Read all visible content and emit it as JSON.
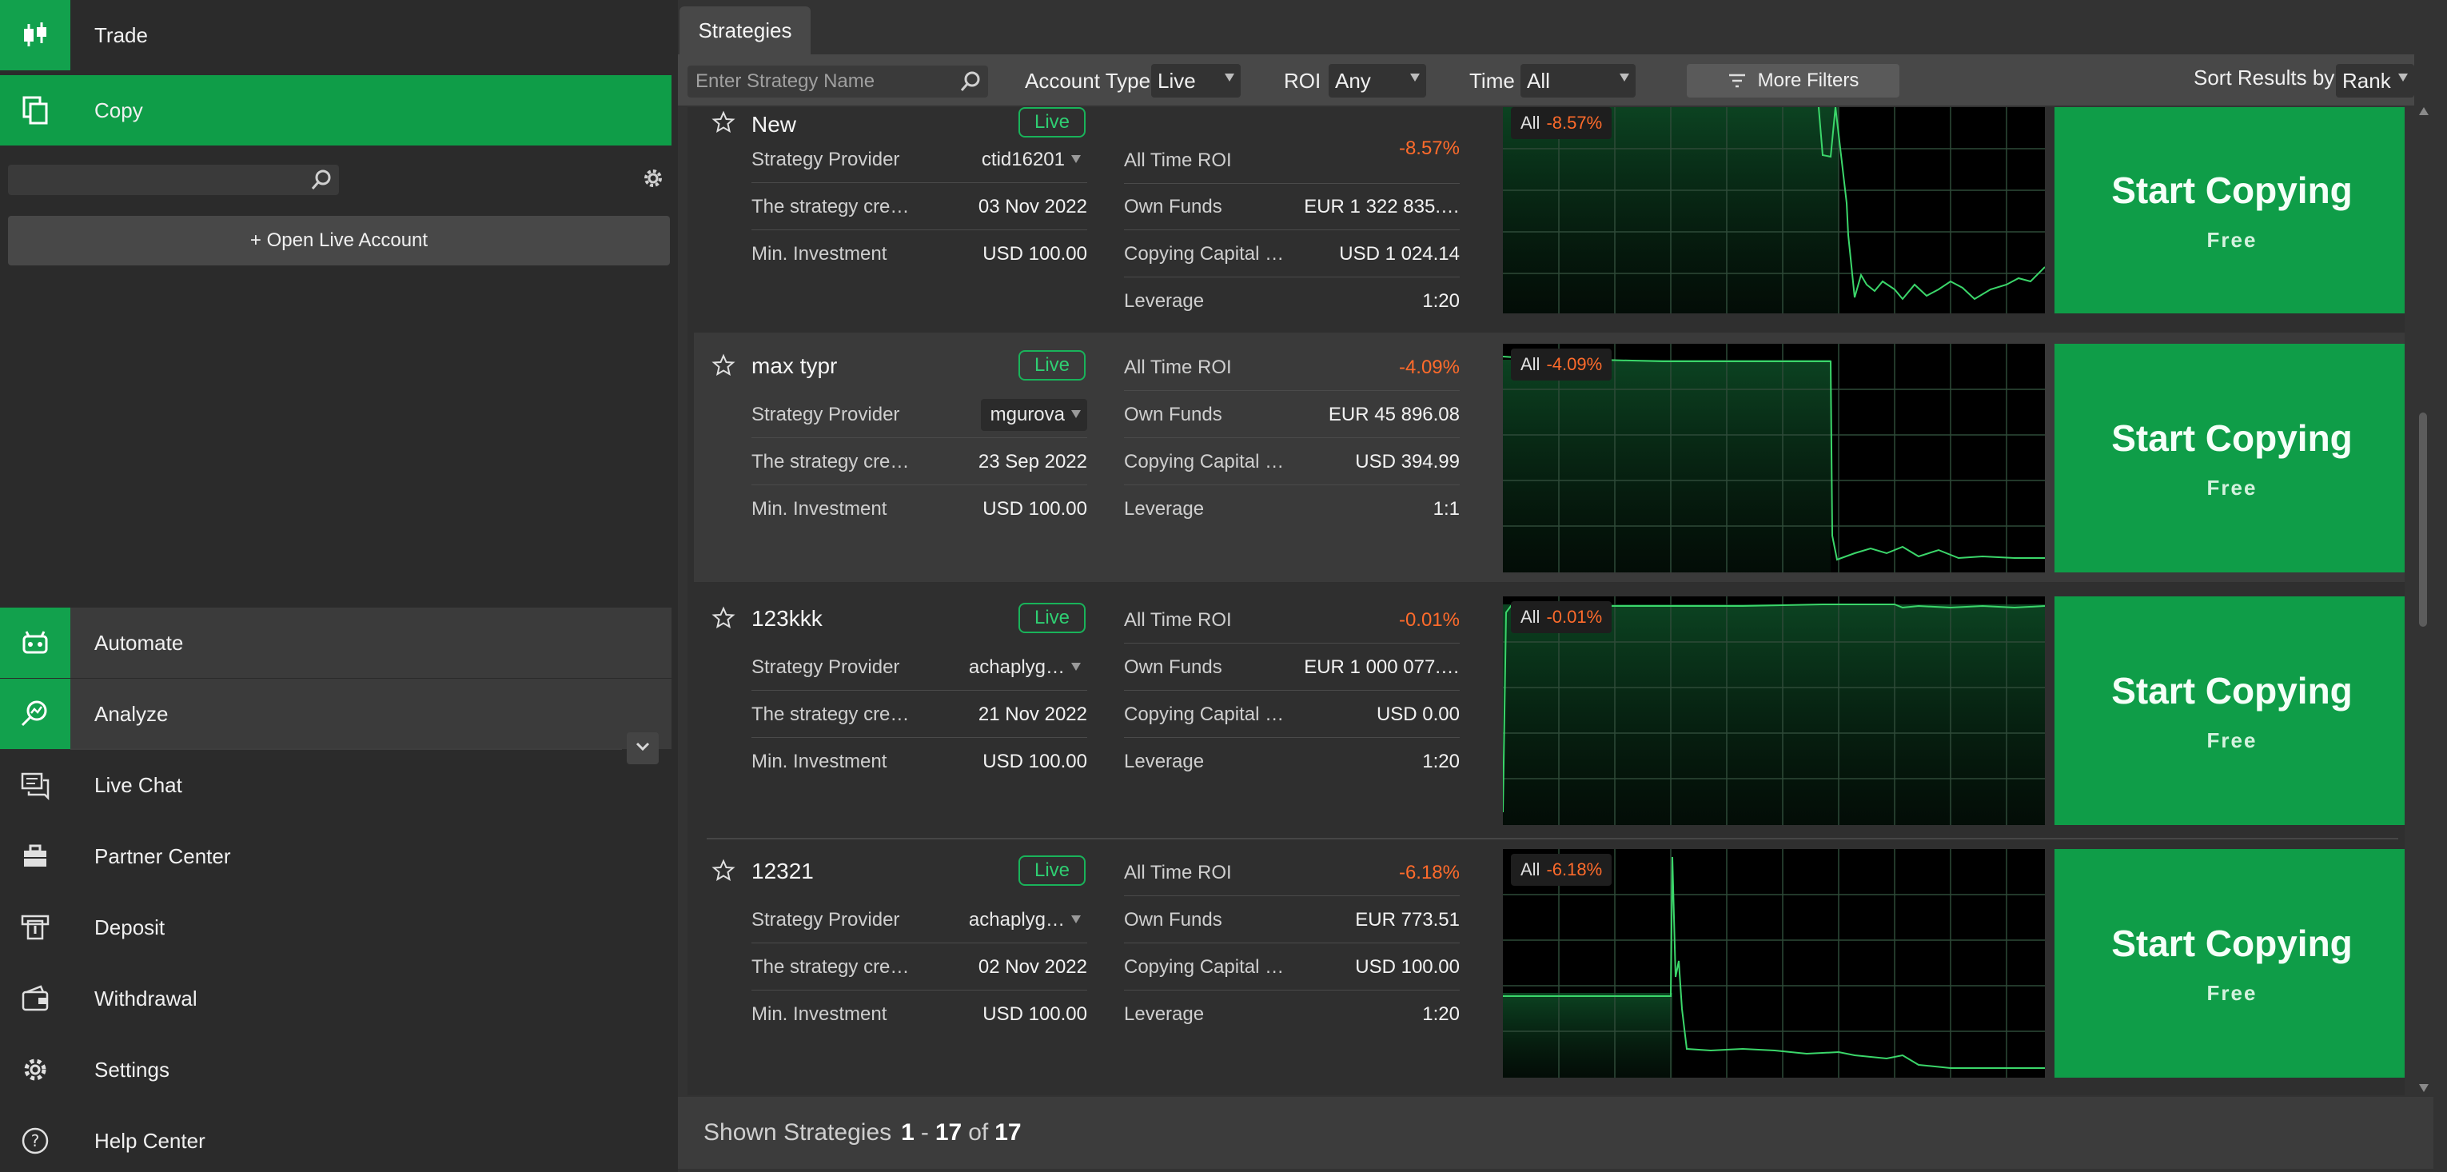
{
  "sidebar": {
    "top_items": [
      {
        "label": "Trade",
        "icon": "candlestick-icon"
      },
      {
        "label": "Copy",
        "icon": "copy-icon"
      }
    ],
    "search": {
      "value": "",
      "placeholder": ""
    },
    "open_account_label": "+ Open Live Account",
    "bottom_items": [
      {
        "label": "Automate",
        "icon": "robot-icon"
      },
      {
        "label": "Analyze",
        "icon": "analyze-icon"
      },
      {
        "label": "Live Chat",
        "icon": "chat-icon"
      },
      {
        "label": "Partner Center",
        "icon": "briefcase-icon"
      },
      {
        "label": "Deposit",
        "icon": "deposit-icon"
      },
      {
        "label": "Withdrawal",
        "icon": "wallet-icon"
      },
      {
        "label": "Settings",
        "icon": "gear-icon"
      },
      {
        "label": "Help Center",
        "icon": "help-icon"
      }
    ]
  },
  "main": {
    "tab_label": "Strategies",
    "filters": {
      "search_placeholder": "Enter Strategy Name",
      "account_type_label": "Account Type",
      "account_type_value": "Live",
      "roi_label": "ROI",
      "roi_value": "Any",
      "time_label": "Time",
      "time_value": "All",
      "more_filters_label": "More Filters",
      "sort_label": "Sort Results by",
      "sort_value": "Rank"
    },
    "field_labels": {
      "provider": "Strategy Provider",
      "created": "The strategy cre…",
      "min_investment": "Min. Investment",
      "all_time_roi": "All Time ROI",
      "own_funds": "Own Funds",
      "copying_capital": "Copying Capital …",
      "leverage": "Leverage"
    },
    "start_copying_label": "Start Copying",
    "free_label": "Free",
    "chart_period_label": "All",
    "live_label": "Live",
    "strategies": [
      {
        "name": "New",
        "provider": "ctid16201",
        "created": "03 Nov 2022",
        "min_investment": "USD 100.00",
        "roi": "-8.57%",
        "own_funds": "EUR 1 322 835.…",
        "copying_capital": "USD 1 024.14",
        "leverage": "1:20"
      },
      {
        "name": "max typr",
        "provider": "mgurova",
        "created": "23 Sep 2022",
        "min_investment": "USD 100.00",
        "roi": "-4.09%",
        "own_funds": "EUR 45 896.08",
        "copying_capital": "USD 394.99",
        "leverage": "1:1"
      },
      {
        "name": "123kkk",
        "provider": "achaplyg…",
        "created": "21 Nov 2022",
        "min_investment": "USD 100.00",
        "roi": "-0.01%",
        "own_funds": "EUR 1 000 077.…",
        "copying_capital": "USD 0.00",
        "leverage": "1:20"
      },
      {
        "name": "12321",
        "provider": "achaplyg…",
        "created": "02 Nov 2022",
        "min_investment": "USD 100.00",
        "roi": "-6.18%",
        "own_funds": "EUR 773.51",
        "copying_capital": "USD 100.00",
        "leverage": "1:20"
      }
    ],
    "footer": {
      "prefix": "Shown Strategies",
      "from": "1",
      "dash": "-",
      "to": "17",
      "of": "of",
      "total": "17"
    },
    "colors": {
      "accent": "#0f9d48",
      "negative": "#ff6b2b",
      "live": "#2fce72"
    }
  }
}
